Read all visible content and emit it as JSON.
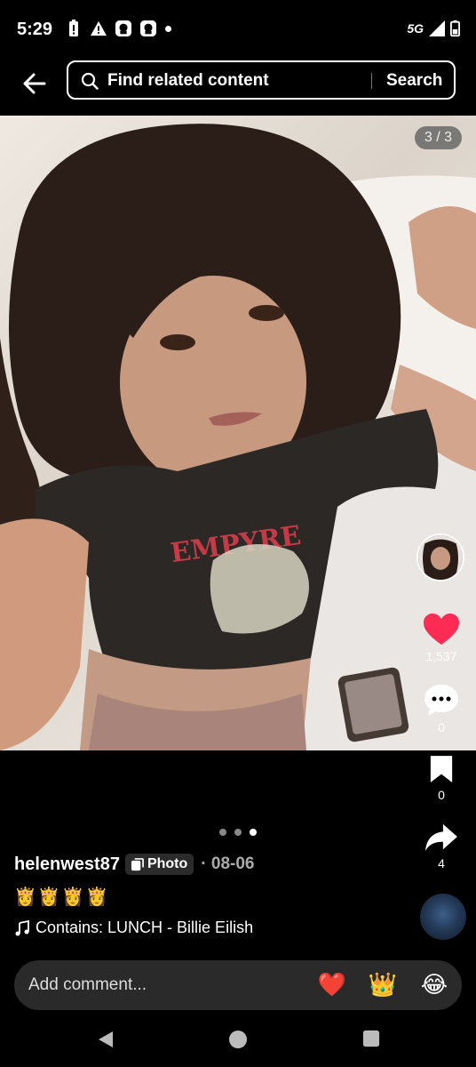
{
  "status": {
    "time": "5:29",
    "network": "5G",
    "icons_left": [
      "battery-alert-icon",
      "warning-icon",
      "app-notification-icon",
      "app-notification-icon"
    ]
  },
  "header": {
    "search_text": "Find related content",
    "search_button": "Search"
  },
  "photo": {
    "counter": "3 / 3",
    "shirt_text": "EMPYRE"
  },
  "actions": {
    "likes": "1,537",
    "comments": "0",
    "bookmarks": "0",
    "shares": "4"
  },
  "carousel": {
    "total": 3,
    "active_index": 2
  },
  "post": {
    "username": "helenwest87",
    "badge": "Photo",
    "date": "· 08-06",
    "caption": "👸👸👸👸",
    "music": "Contains: LUNCH - Billie Eilish"
  },
  "comment": {
    "placeholder": "Add comment...",
    "emojis": [
      "❤️",
      "👑",
      "😂"
    ]
  },
  "colors": {
    "like_red": "#fe2c55",
    "background": "#000000"
  }
}
